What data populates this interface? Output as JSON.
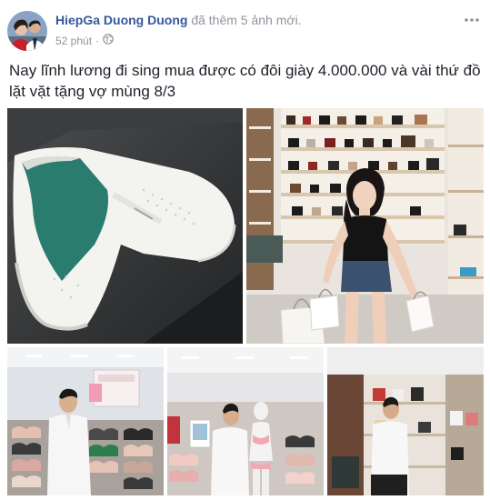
{
  "post": {
    "author": "HiepGa Duong Duong",
    "action": " đã thêm 5 ảnh mới.",
    "time": "52 phút",
    "separator": "·",
    "privacy_icon": "globe-icon",
    "more_icon": "more-options-icon",
    "text": "Nay lĩnh lương đi sing mua được có đôi giày 4.000.000 và vài thứ đồ lặt vặt tặng vợ mùng 8/3"
  },
  "colors": {
    "author_link": "#365899",
    "meta_gray": "#90949c",
    "text": "#1d2129"
  }
}
